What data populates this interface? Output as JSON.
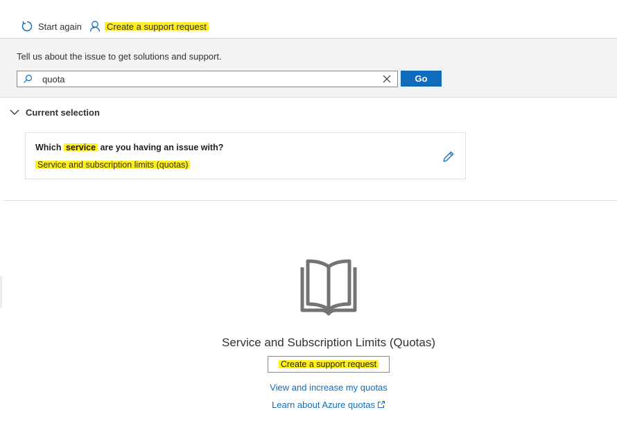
{
  "toolbar": {
    "start_again_label": "Start again",
    "create_request_label": "Create a support request"
  },
  "search": {
    "prompt": "Tell us about the issue to get solutions and support.",
    "value": "quota",
    "go_label": "Go"
  },
  "current_selection": {
    "header": "Current selection",
    "question_prefix": "Which ",
    "question_highlight": "service",
    "question_suffix": " are you having an issue with?",
    "answer": "Service and subscription limits (quotas)"
  },
  "result": {
    "title": "Service and Subscription Limits (Quotas)",
    "create_button_label": "Create a support request",
    "link_view_quotas": "View and increase my quotas",
    "link_learn": "Learn about Azure quotas"
  },
  "icons": {
    "start_again": "refresh-icon",
    "create_request": "person-support-icon",
    "search": "search-icon",
    "clear": "close-icon",
    "collapse": "chevron-down-icon",
    "edit": "pencil-icon",
    "result": "book-open-icon",
    "external": "external-link-icon"
  },
  "colors": {
    "accent": "#0f6cbd",
    "highlight": "#ffee00",
    "band_background": "#f3f3f3"
  }
}
